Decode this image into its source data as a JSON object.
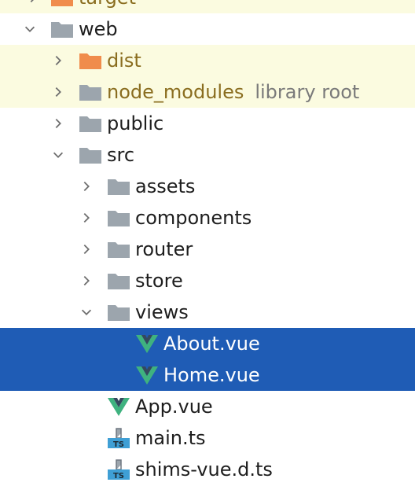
{
  "colors": {
    "folder_gray": "#9ca5ad",
    "folder_orange": "#f08c4c",
    "highlight_bg": "#fbfbe0",
    "selected_bg": "#1f5cb5",
    "vue_green": "#3fb27f",
    "vue_dark": "#35495e",
    "ts_blue": "#3f9fd5"
  },
  "tree": {
    "target": {
      "label": "target",
      "icon": "folder-icon"
    },
    "web": {
      "label": "web",
      "icon": "folder-icon"
    },
    "dist": {
      "label": "dist",
      "icon": "folder-icon"
    },
    "node_modules": {
      "label": "node_modules",
      "hint": "library root",
      "icon": "folder-icon"
    },
    "public": {
      "label": "public",
      "icon": "folder-icon"
    },
    "src": {
      "label": "src",
      "icon": "folder-icon"
    },
    "assets": {
      "label": "assets",
      "icon": "folder-icon"
    },
    "components": {
      "label": "components",
      "icon": "folder-icon"
    },
    "router": {
      "label": "router",
      "icon": "folder-icon"
    },
    "store": {
      "label": "store",
      "icon": "folder-icon"
    },
    "views": {
      "label": "views",
      "icon": "folder-icon"
    },
    "about": {
      "label": "About.vue",
      "icon": "vue-icon"
    },
    "home": {
      "label": "Home.vue",
      "icon": "vue-icon"
    },
    "app": {
      "label": "App.vue",
      "icon": "vue-icon"
    },
    "main": {
      "label": "main.ts",
      "badge": "TS",
      "icon": "typescript-file-icon"
    },
    "shims": {
      "label": "shims-vue.d.ts",
      "badge": "TS",
      "icon": "typescript-file-icon"
    }
  }
}
